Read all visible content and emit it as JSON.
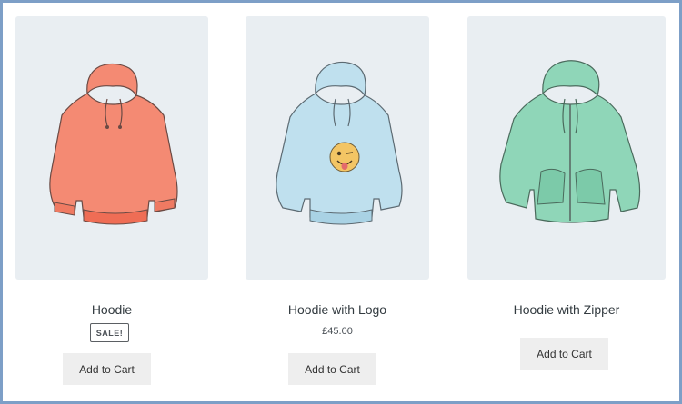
{
  "products": [
    {
      "name": "Hoodie",
      "badge": "SALE!",
      "button": "Add to Cart",
      "image_icon": "hoodie-icon",
      "color": "#f48a73"
    },
    {
      "name": "Hoodie with Logo",
      "price": "£45.00",
      "button": "Add to Cart",
      "image_icon": "hoodie-with-logo-icon",
      "color": "#bfe0ee"
    },
    {
      "name": "Hoodie with Zipper",
      "button": "Add to Cart",
      "image_icon": "hoodie-with-zipper-icon",
      "color": "#8fd6b8"
    }
  ]
}
